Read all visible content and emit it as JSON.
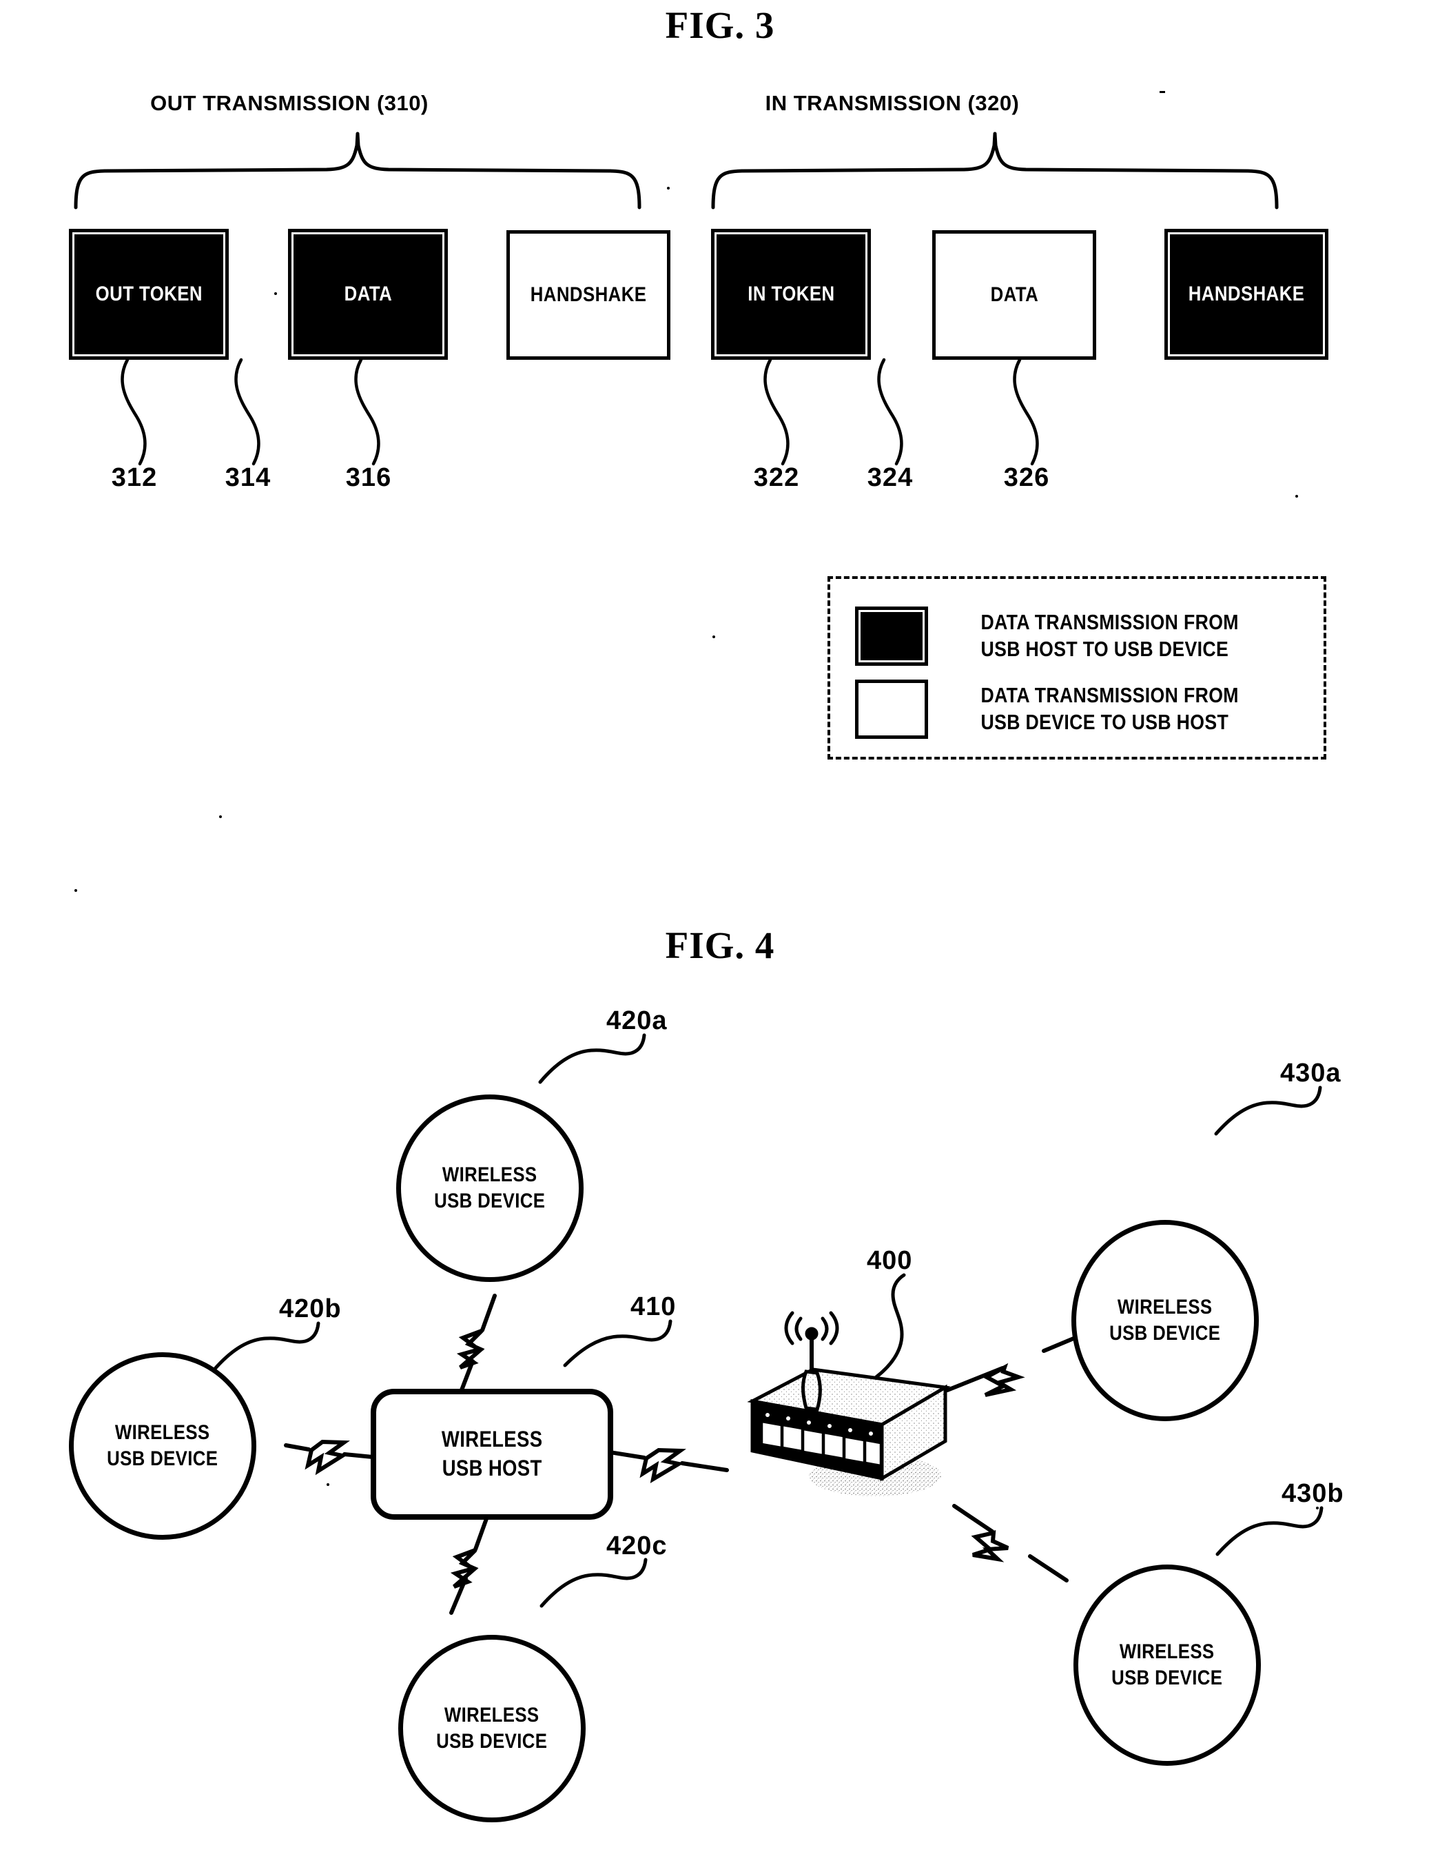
{
  "page": {
    "background": "#ffffff",
    "ink": "#000000"
  },
  "figures": [
    {
      "id": "fig3",
      "title": "FIG. 3",
      "groups": [
        {
          "id": "out",
          "label": "OUT TRANSMISSION (310)"
        },
        {
          "id": "in",
          "label": "IN TRANSMISSION (320)"
        }
      ],
      "packets": [
        {
          "id": "out-token",
          "label": "OUT TOKEN",
          "ref": "312",
          "fill": "filled"
        },
        {
          "id": "out-data",
          "label": "DATA",
          "ref": "314",
          "fill": "filled"
        },
        {
          "id": "out-handshake",
          "label": "HANDSHAKE",
          "ref": "316",
          "fill": "hollow"
        },
        {
          "id": "in-token",
          "label": "IN TOKEN",
          "ref": "322",
          "fill": "filled"
        },
        {
          "id": "in-data",
          "label": "DATA",
          "ref": "324",
          "fill": "hollow"
        },
        {
          "id": "in-handshake",
          "label": "HANDSHAKE",
          "ref": "326",
          "fill": "filled"
        }
      ],
      "legend": [
        {
          "swatch": "filled",
          "line1": "DATA TRANSMISSION FROM",
          "line2": "USB HOST TO USB DEVICE"
        },
        {
          "swatch": "hollow",
          "line1": "DATA TRANSMISSION FROM",
          "line2": "USB DEVICE TO USB HOST"
        }
      ]
    },
    {
      "id": "fig4",
      "title": "FIG. 4",
      "nodes": [
        {
          "id": "device-420a",
          "line1": "WIRELESS",
          "line2": "USB DEVICE",
          "ref": "420a"
        },
        {
          "id": "device-420b",
          "line1": "WIRELESS",
          "line2": "USB DEVICE",
          "ref": "420b"
        },
        {
          "id": "device-420c",
          "line1": "WIRELESS",
          "line2": "USB DEVICE",
          "ref": "420c"
        },
        {
          "id": "device-430a",
          "line1": "WIRELESS",
          "line2": "USB DEVICE",
          "ref": "430a"
        },
        {
          "id": "device-430b",
          "line1": "WIRELESS",
          "line2": "USB DEVICE",
          "ref": "430b"
        }
      ],
      "host": {
        "id": "host-410",
        "line1": "WIRELESS",
        "line2": "USB HOST",
        "ref": "410"
      },
      "hub": {
        "id": "hub-400",
        "ref": "400"
      }
    }
  ]
}
